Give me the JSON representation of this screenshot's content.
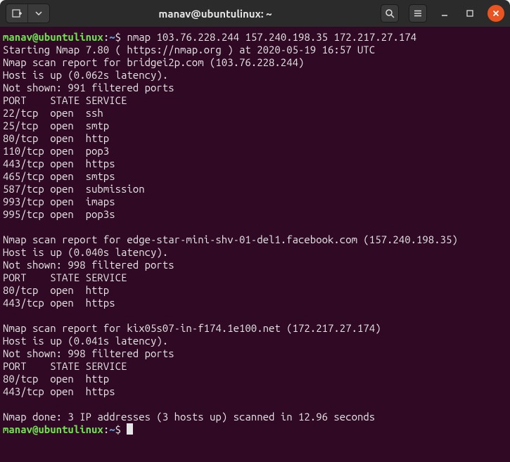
{
  "titlebar": {
    "title": "manav@ubuntulinux: ~"
  },
  "prompt": {
    "user_host": "manav@ubuntulinux",
    "sep": ":",
    "path": "~",
    "symbol": "$"
  },
  "command": "nmap 103.76.228.244 157.240.198.35 172.217.27.174",
  "output": {
    "start": "Starting Nmap 7.80 ( https://nmap.org ) at 2020-05-19 16:57 UTC",
    "hosts": [
      {
        "report": "Nmap scan report for bridgei2p.com (103.76.228.244)",
        "hostup": "Host is up (0.062s latency).",
        "notshown": "Not shown: 991 filtered ports",
        "header": "PORT    STATE SERVICE",
        "ports": [
          "22/tcp  open  ssh",
          "25/tcp  open  smtp",
          "80/tcp  open  http",
          "110/tcp open  pop3",
          "443/tcp open  https",
          "465/tcp open  smtps",
          "587/tcp open  submission",
          "993/tcp open  imaps",
          "995/tcp open  pop3s"
        ]
      },
      {
        "report": "Nmap scan report for edge-star-mini-shv-01-del1.facebook.com (157.240.198.35)",
        "hostup": "Host is up (0.040s latency).",
        "notshown": "Not shown: 998 filtered ports",
        "header": "PORT    STATE SERVICE",
        "ports": [
          "80/tcp  open  http",
          "443/tcp open  https"
        ]
      },
      {
        "report": "Nmap scan report for kix05s07-in-f174.1e100.net (172.217.27.174)",
        "hostup": "Host is up (0.041s latency).",
        "notshown": "Not shown: 998 filtered ports",
        "header": "PORT    STATE SERVICE",
        "ports": [
          "80/tcp  open  http",
          "443/tcp open  https"
        ]
      }
    ],
    "done": "Nmap done: 3 IP addresses (3 hosts up) scanned in 12.96 seconds"
  }
}
